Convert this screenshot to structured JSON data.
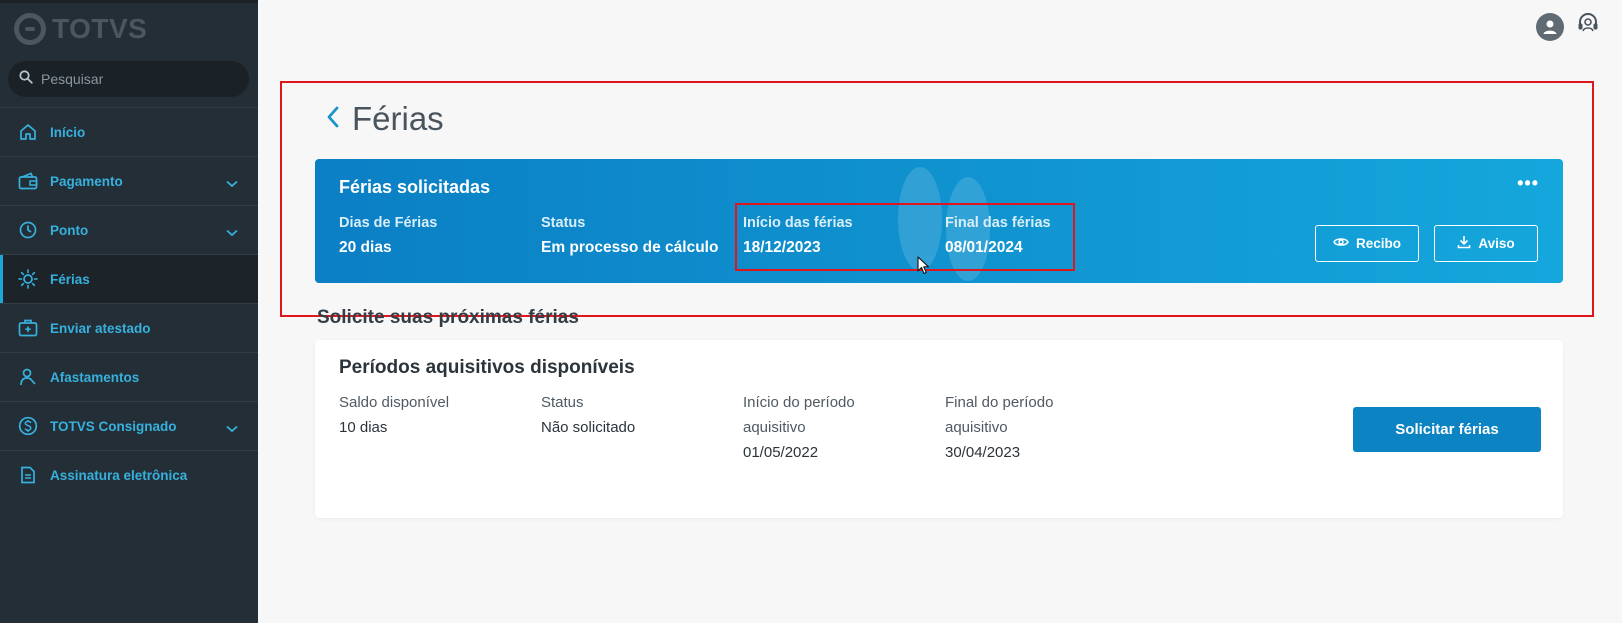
{
  "app": {
    "logo_text": "TOTVS"
  },
  "search": {
    "placeholder": "Pesquisar"
  },
  "sidebar": {
    "items": [
      {
        "label": "Início",
        "icon": "home-icon"
      },
      {
        "label": "Pagamento",
        "icon": "wallet-icon"
      },
      {
        "label": "Ponto",
        "icon": "clock-icon"
      },
      {
        "label": "Férias",
        "icon": "sun-icon"
      },
      {
        "label": "Enviar atestado",
        "icon": "medical-kit-icon"
      },
      {
        "label": "Afastamentos",
        "icon": "person-icon"
      },
      {
        "label": "TOTVS Consignado",
        "icon": "dollar-icon"
      },
      {
        "label": "Assinatura eletrônica",
        "icon": "document-icon"
      }
    ]
  },
  "header": {
    "title": "Férias"
  },
  "requested": {
    "title": "Férias solicitadas",
    "more": "•••",
    "fields": [
      {
        "label": "Dias de Férias",
        "value": "20 dias"
      },
      {
        "label": "Status",
        "value": "Em processo de cálculo"
      },
      {
        "label": "Início das férias",
        "value": "18/12/2023"
      },
      {
        "label": "Final das férias",
        "value": "08/01/2024"
      }
    ],
    "receipt_label": "Recibo",
    "notice_label": "Aviso"
  },
  "next": {
    "section_title": "Solicite suas próximas férias",
    "card_title": "Períodos aquisitivos disponíveis",
    "fields": [
      {
        "label": "Saldo disponível",
        "value": "10 dias"
      },
      {
        "label": "Status",
        "value": "Não solicitado"
      },
      {
        "label_1": "Início do período",
        "label_2": "aquisitivo",
        "value": "01/05/2022"
      },
      {
        "label_1": "Final do período",
        "label_2": "aquisitivo",
        "value": "30/04/2023"
      }
    ],
    "button_label": "Solicitar férias"
  },
  "colors": {
    "accent": "#1ea7d6",
    "sidebar": "#242e36",
    "highlight": "#e0161e",
    "primary_button": "#0c83c2"
  }
}
